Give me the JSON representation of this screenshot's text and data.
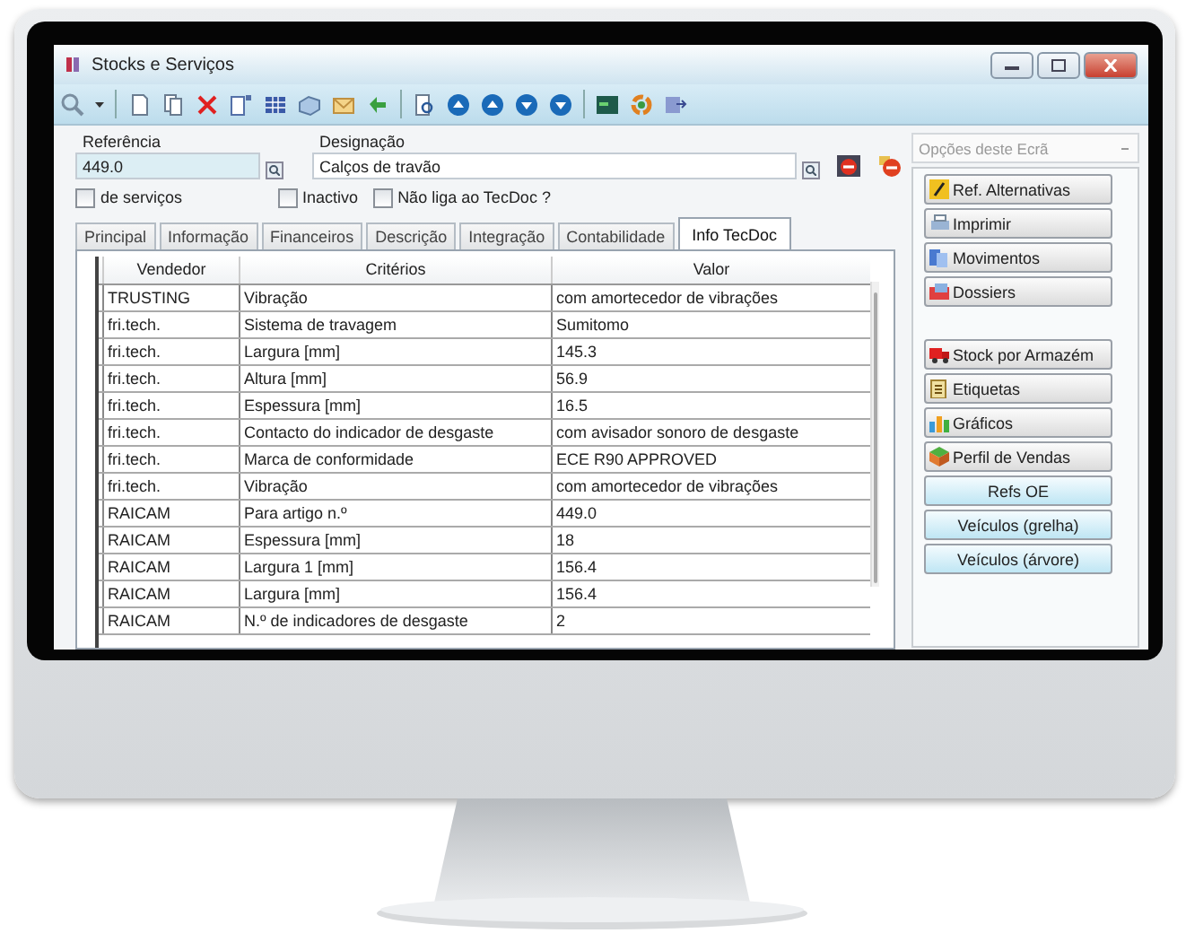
{
  "window": {
    "title": "Stocks e Serviços"
  },
  "form": {
    "reference_label": "Referência",
    "reference": "449.0",
    "designation_label": "Designação",
    "designation": "Calços de travão",
    "checkboxes": [
      {
        "label": "de serviços",
        "checked": false
      },
      {
        "label": "Inactivo",
        "checked": false
      },
      {
        "label": "Não liga ao TecDoc ?",
        "checked": false
      }
    ]
  },
  "tabs": [
    {
      "label": "Principal",
      "selected": false
    },
    {
      "label": "Informação",
      "selected": false
    },
    {
      "label": "Financeiros",
      "selected": false
    },
    {
      "label": "Descrição",
      "selected": false
    },
    {
      "label": "Integração",
      "selected": false
    },
    {
      "label": "Contabilidade",
      "selected": false
    },
    {
      "label": "Info TecDoc",
      "selected": true
    }
  ],
  "table": {
    "columns": [
      "Vendedor",
      "Critérios",
      "Valor"
    ],
    "rows": [
      [
        "TRUSTING",
        "Vibração",
        "com amortecedor de vibrações"
      ],
      [
        "fri.tech.",
        "Sistema de travagem",
        "Sumitomo"
      ],
      [
        "fri.tech.",
        "Largura [mm]",
        "145.3"
      ],
      [
        "fri.tech.",
        "Altura [mm]",
        "56.9"
      ],
      [
        "fri.tech.",
        "Espessura [mm]",
        "16.5"
      ],
      [
        "fri.tech.",
        "Contacto do indicador de desgaste",
        "com avisador sonoro de desgaste"
      ],
      [
        "fri.tech.",
        "Marca de conformidade",
        "ECE R90 APPROVED"
      ],
      [
        "fri.tech.",
        "Vibração",
        "com amortecedor de vibrações"
      ],
      [
        "RAICAM",
        "Para artigo n.º",
        "449.0"
      ],
      [
        "RAICAM",
        "Espessura [mm]",
        "18"
      ],
      [
        "RAICAM",
        "Largura 1 [mm]",
        "156.4"
      ],
      [
        "RAICAM",
        "Largura [mm]",
        "156.4"
      ],
      [
        "RAICAM",
        "N.º de indicadores de desgaste",
        "2"
      ]
    ]
  },
  "side_panel": {
    "dropdown": "Opções deste Ecrã",
    "groups": [
      [
        {
          "label": "Ref. Alternativas",
          "kind": "icon"
        },
        {
          "label": "Imprimir",
          "kind": "icon"
        },
        {
          "label": "Movimentos",
          "kind": "icon"
        },
        {
          "label": "Dossiers",
          "kind": "icon"
        }
      ],
      [
        {
          "label": "Stock por Armazém",
          "kind": "icon"
        },
        {
          "label": "Etiquetas",
          "kind": "icon"
        },
        {
          "label": "Gráficos",
          "kind": "icon"
        },
        {
          "label": "Perfil de Vendas",
          "kind": "icon"
        },
        {
          "label": "Refs OE",
          "kind": "plain"
        },
        {
          "label": "Veículos (grelha)",
          "kind": "plain"
        },
        {
          "label": "Veículos (árvore)",
          "kind": "plain"
        }
      ]
    ]
  }
}
